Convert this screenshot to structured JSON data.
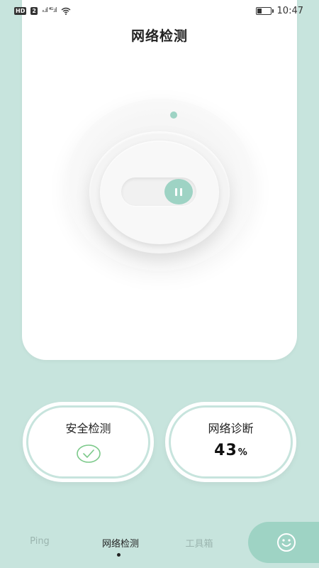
{
  "status_bar": {
    "badge_hd": "HD",
    "badge_sim": "2",
    "signal_text": "ₓ.ıl ⁴ᴳ.ıl",
    "wifi_icon": "wifi-icon",
    "battery_level": 0.3,
    "time": "10:47"
  },
  "main": {
    "title": "网络检测",
    "control_icon": "pause-icon"
  },
  "cards": {
    "security": {
      "title": "安全检测",
      "icon": "check-circle-icon",
      "accent": "#7cc98a"
    },
    "diagnosis": {
      "title": "网络诊断",
      "percent": "43",
      "unit": "%"
    }
  },
  "nav": {
    "items": [
      {
        "label": "Ping"
      },
      {
        "label": "网络检测",
        "active": true
      },
      {
        "label": "工具箱"
      }
    ],
    "fab_icon": "smiley-icon"
  },
  "colors": {
    "background": "#c7e4dd",
    "accent": "#9ed3c4",
    "card": "#ffffff"
  }
}
